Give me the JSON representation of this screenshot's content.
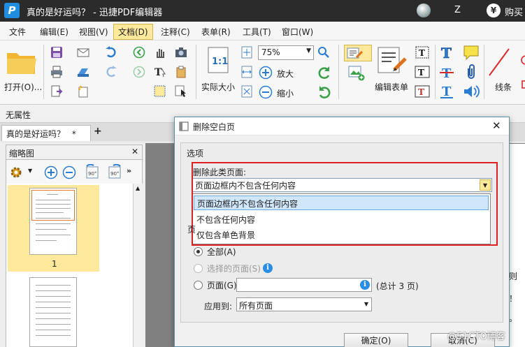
{
  "window": {
    "title": "真的是好运吗？ - 迅捷PDF编辑器",
    "user_initial": "Z",
    "currency_symbol": "¥",
    "buy_label": "购买"
  },
  "menu": [
    "文件",
    "编辑(E)",
    "视图(V)",
    "文档(D)",
    "注释(C)",
    "表单(R)",
    "工具(T)",
    "窗口(W)"
  ],
  "ribbon": {
    "open_label": "打开(O)...",
    "zoom_value": "75%",
    "actual_size_label": "实际大小",
    "actual_size_icon_text": "1:1",
    "zoom_in_label": "放大",
    "zoom_out_label": "缩小",
    "edit_form_label": "编辑表单",
    "line_label": "线条",
    "text_tool_icon_text": "T"
  },
  "property_bar": {
    "label": "无属性"
  },
  "doc_tab": {
    "title": "真的是好运吗？",
    "modified_mark": "*",
    "add_label": "+"
  },
  "thumbnail_panel": {
    "title": "缩略图",
    "pages": [
      {
        "number": "1"
      }
    ]
  },
  "doc_fragments": [
    "强则",
    "望！",
    "可。"
  ],
  "dialog": {
    "title": "删除空白页",
    "options_group": "选项",
    "delete_type_label": "删除此类页面:",
    "combo_value": "页面边框内不包含任何内容",
    "dropdown_options": [
      "页面边框内不包含任何内容",
      "不包含任何内容",
      "仅包含单色背景"
    ],
    "selected_option_index": 0,
    "range_label_partial": "页",
    "radio_all": "全部(A)",
    "radio_selected": "选择的页面(S)",
    "radio_pages": "页面(G)",
    "total_pages_text": "(总计 3 页)",
    "apply_to_label": "应用到:",
    "apply_to_value": "所有页面",
    "ok_label": "确定(O)",
    "cancel_label": "取消(C)",
    "close_label": "✕"
  },
  "watermark": "@51CTO博客",
  "colors": {
    "titlebar": "#2b2b2b",
    "accent_red_box": "#e02020",
    "selected_option": "#cfe6fb",
    "info_icon": "#2a8de6",
    "logo_blue": "#1f8de0"
  }
}
